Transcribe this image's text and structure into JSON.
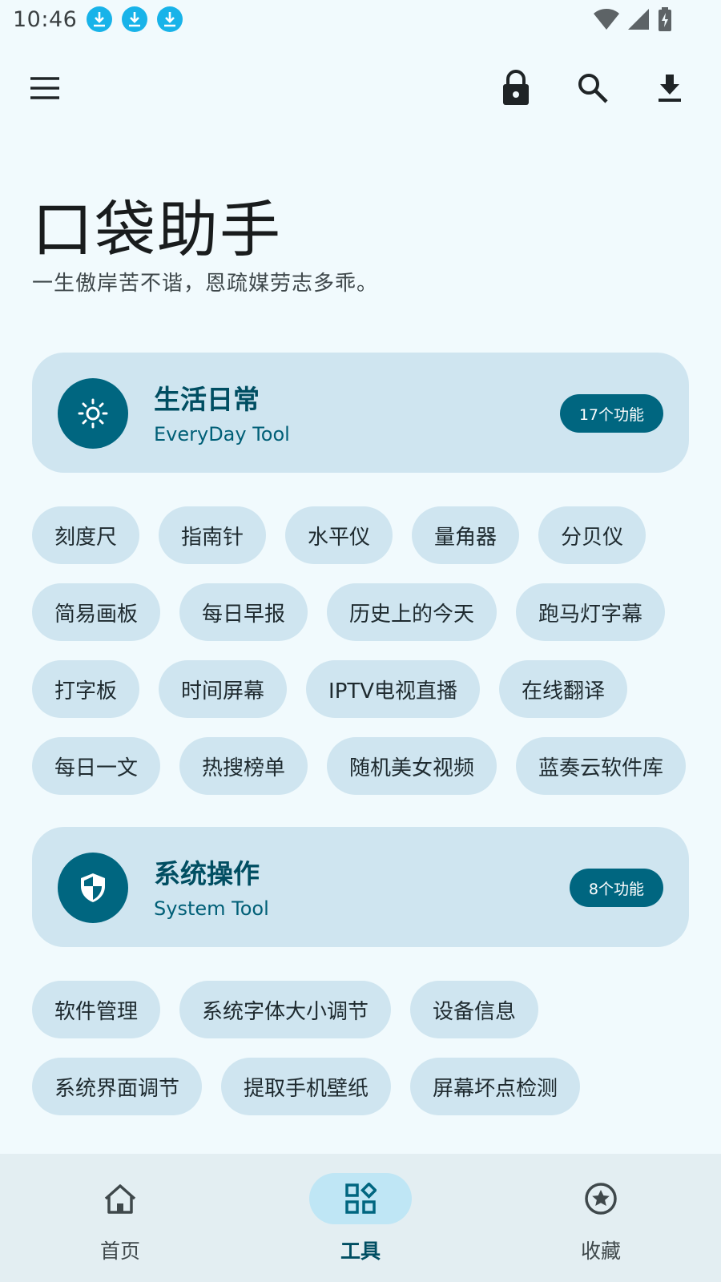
{
  "status_bar": {
    "time": "10:46",
    "notifications": [
      "download-icon",
      "download-icon",
      "download-icon"
    ],
    "system_icons": [
      "wifi-icon",
      "signal-icon",
      "battery-charging-icon"
    ]
  },
  "top_bar": {
    "actions": [
      "menu-icon",
      "lock-icon",
      "search-icon",
      "download-icon"
    ]
  },
  "header": {
    "title": "口袋助手",
    "subtitle": "一生傲岸苦不谐，恩疏媒劳志多乖。"
  },
  "sections": [
    {
      "icon": "brightness-icon",
      "title": "生活日常",
      "subtitle": "EveryDay Tool",
      "count": "17个功能",
      "tools": [
        "刻度尺",
        "指南针",
        "水平仪",
        "量角器",
        "分贝仪",
        "简易画板",
        "每日早报",
        "历史上的今天",
        "跑马灯字幕",
        "打字板",
        "时间屏幕",
        "IPTV电视直播",
        "在线翻译",
        "每日一文",
        "热搜榜单",
        "随机美女视频",
        "蓝奏云软件库"
      ]
    },
    {
      "icon": "shield-icon",
      "title": "系统操作",
      "subtitle": "System Tool",
      "count": "8个功能",
      "tools": [
        "软件管理",
        "系统字体大小调节",
        "设备信息",
        "系统界面调节",
        "提取手机壁纸",
        "屏幕坏点检测"
      ]
    }
  ],
  "bottom_nav": {
    "items": [
      {
        "label": "首页",
        "icon": "home-icon",
        "active": false
      },
      {
        "label": "工具",
        "icon": "widgets-icon",
        "active": true
      },
      {
        "label": "收藏",
        "icon": "star-circle-icon",
        "active": false
      }
    ]
  },
  "colors": {
    "background": "#F1FAFD",
    "card": "#CFE5F0",
    "accent": "#006680",
    "accent_text": "#004E62",
    "nav_background": "#E3EEF2",
    "nav_active_pill": "#BFE6F5",
    "notification_blue": "#18B3E9"
  }
}
